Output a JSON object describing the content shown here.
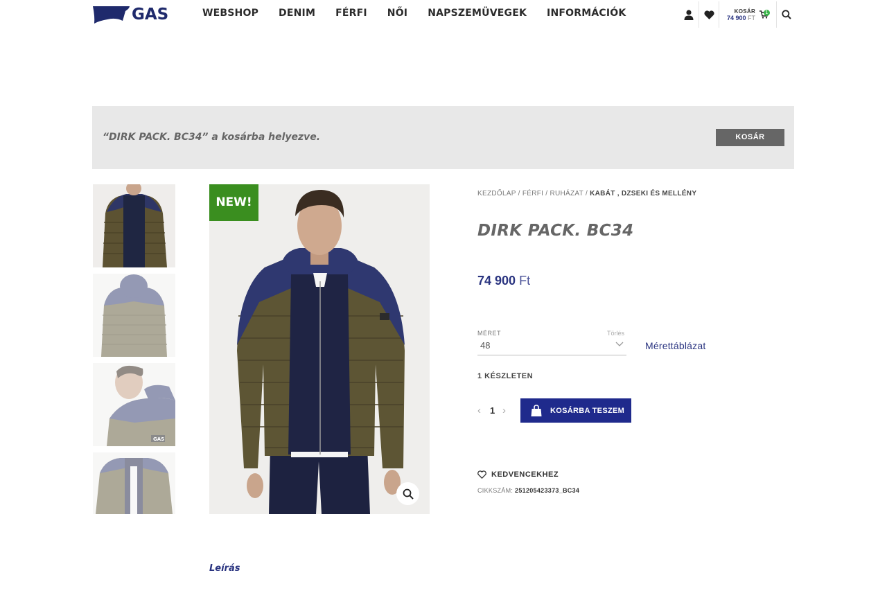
{
  "header": {
    "logo_text": "GAS",
    "nav": [
      "WEBSHOP",
      "DENIM",
      "FÉRFI",
      "NŐI",
      "NAPSZEMÜVEGEK",
      "INFORMÁCIÓK"
    ],
    "cart": {
      "label": "KOSÁR",
      "amount": "74 900",
      "currency": "FT",
      "count": "1"
    }
  },
  "notice": {
    "message": "“DIRK PACK. BC34” a kosárba helyezve.",
    "button": "KOSÁR"
  },
  "gallery": {
    "badge": "NEW!",
    "thumbnail_count": 4
  },
  "product": {
    "breadcrumb": [
      "KEZDŐLAP",
      "FÉRFI",
      "RUHÁZAT"
    ],
    "breadcrumb_current": "KABÁT , DZSEKI ÉS MELLÉNY",
    "title": "DIRK PACK. BC34",
    "price": "74 900",
    "currency": "Ft",
    "size_label": "MÉRET",
    "clear_label": "Törlés",
    "size_value": "48",
    "size_chart": "Mérettáblázat",
    "stock": "1 KÉSZLETEN",
    "quantity": "1",
    "add_to_cart": "KOSÁRBA TESZEM",
    "wishlist": "KEDVENCEKHEZ",
    "sku_label": "CIKKSZÁM:",
    "sku": "251205423373_BC34"
  },
  "tabs": {
    "description": "Leírás"
  },
  "colors": {
    "brand_navy": "#1f2a8c",
    "badge_green": "#3a8e1f",
    "notice_bg": "#e8e8e8",
    "notice_button": "#666666"
  }
}
